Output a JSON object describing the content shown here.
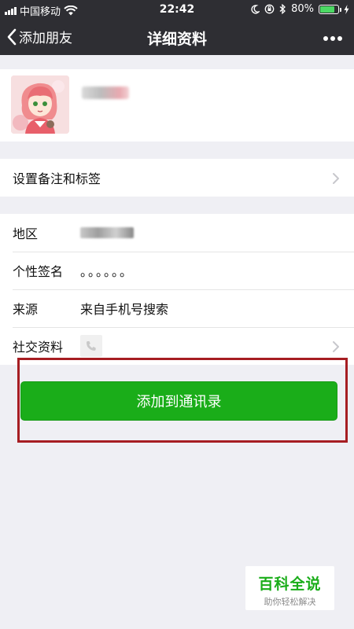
{
  "status_bar": {
    "carrier": "中国移动",
    "time": "22:42",
    "battery": "80%",
    "battery_level": 0.8
  },
  "nav": {
    "back_label": "添加朋友",
    "title": "详细资料",
    "more_icon": "more-icon"
  },
  "rows": {
    "remark": "设置备注和标签",
    "region_label": "地区",
    "signature_label": "个性签名",
    "signature_value": "。。。。。。",
    "source_label": "来源",
    "source_value": "来自手机号搜索",
    "social_label": "社交资料"
  },
  "add_button": "添加到通讯录",
  "watermark": {
    "title": "百科全说",
    "subtitle": "助你轻松解决"
  },
  "colors": {
    "nav_bg": "#2e2e33",
    "accent_green": "#1aad19",
    "highlight_red": "#a61d22"
  }
}
